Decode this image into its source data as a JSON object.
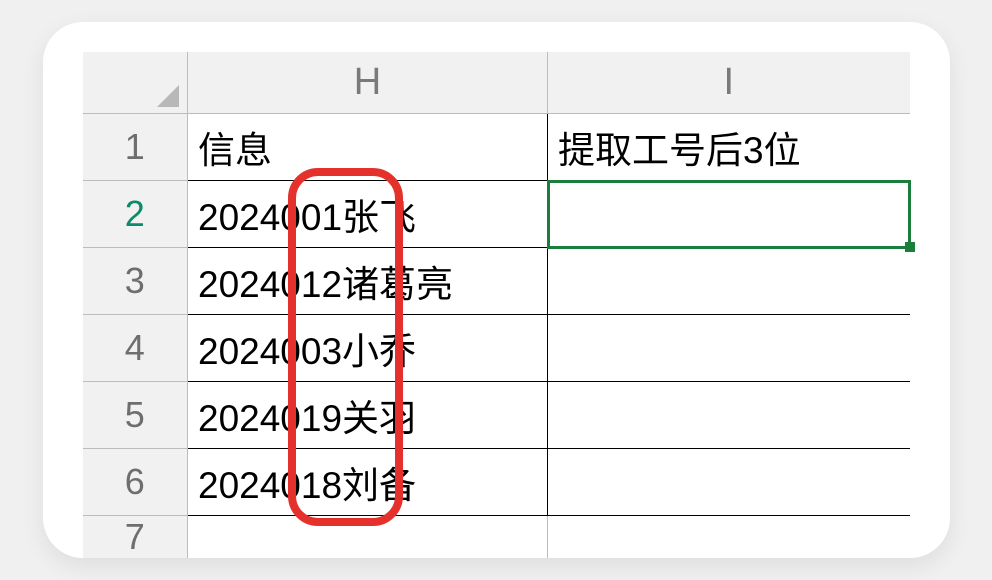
{
  "columns": {
    "H": "H",
    "I": "I"
  },
  "rows": [
    "1",
    "2",
    "3",
    "4",
    "5",
    "6",
    "7"
  ],
  "header": {
    "info": "信息",
    "extract": "提取工号后3位"
  },
  "data": [
    {
      "code": "2024001",
      "name": "张飞"
    },
    {
      "code": "2024012",
      "name": "诸葛亮"
    },
    {
      "code": "2024003",
      "name": "小乔"
    },
    {
      "code": "2024019",
      "name": "关羽"
    },
    {
      "code": "2024018",
      "name": "刘备"
    }
  ],
  "active_cell": "I2",
  "highlight": {
    "target": "last-3-digits",
    "color": "#e4312b"
  }
}
